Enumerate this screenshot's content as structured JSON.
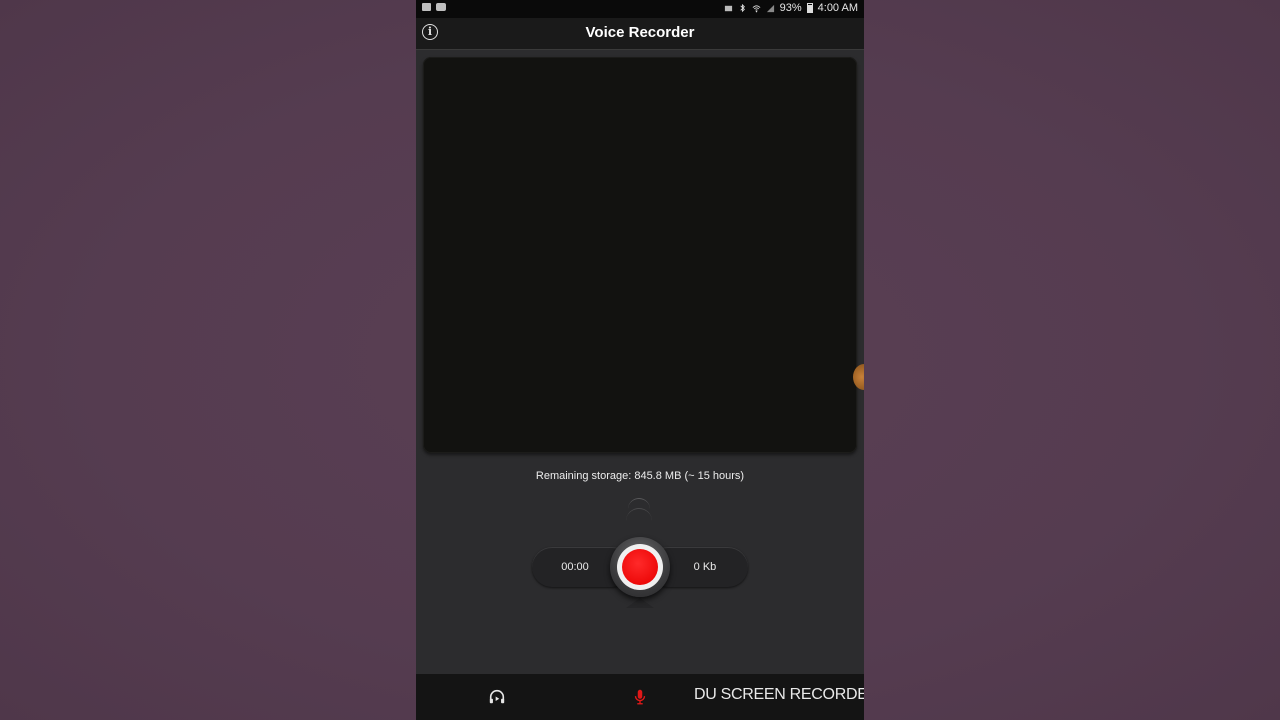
{
  "status_bar": {
    "battery": "93%",
    "time": "4:00 AM"
  },
  "app_bar": {
    "title": "Voice Recorder",
    "info_label": "i"
  },
  "storage": {
    "text": "Remaining storage: 845.8 MB (~ 15 hours)"
  },
  "recorder": {
    "elapsed": "00:00",
    "size": "0 Kb"
  },
  "bottom_bar": {
    "icons": [
      "headphones-play-icon",
      "microphone-icon"
    ],
    "watermark": "DU SCREEN RECORDER"
  },
  "colors": {
    "record": "#ee0a0a",
    "background": "#553c50",
    "panel": "#2c2c2e"
  }
}
